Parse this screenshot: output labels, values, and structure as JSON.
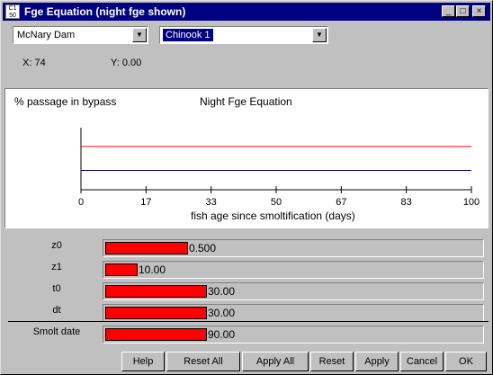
{
  "window": {
    "title": "Fge Equation (night fge shown)",
    "icon_text": "C1 50",
    "controls": {
      "minimize": "_",
      "maximize": "□",
      "close": "×"
    }
  },
  "selectors": {
    "dam": {
      "value": "McNary Dam",
      "arrow": "▼"
    },
    "species": {
      "value": "Chinook 1",
      "arrow": "▼"
    }
  },
  "coords": {
    "x": "X: 74",
    "y": "Y: 0.00"
  },
  "chart_data": {
    "type": "line",
    "title": "Night Fge Equation",
    "ylabel": "% passage in bypass",
    "xlabel": "fish age since smoltification (days)",
    "x_ticks": [
      "0",
      "17",
      "33",
      "50",
      "67",
      "83",
      "100"
    ],
    "xlim": [
      0,
      100
    ],
    "series": [
      {
        "color": "#ff0000",
        "x": [
          0,
          100
        ],
        "level": 0.74
      },
      {
        "color": "#000080",
        "x": [
          0,
          100
        ],
        "level": 0.33
      }
    ],
    "grid": false
  },
  "params": [
    {
      "name": "z0",
      "value": "0.500",
      "fraction": 0.22
    },
    {
      "name": "z1",
      "value": "10.00",
      "fraction": 0.085
    },
    {
      "name": "t0",
      "value": "30.00",
      "fraction": 0.27
    },
    {
      "name": "dt",
      "value": "30.00",
      "fraction": 0.27
    },
    {
      "name": "Smolt date",
      "value": "90.00",
      "fraction": 0.27
    }
  ],
  "buttons": {
    "help": "Help",
    "reset_all": "Reset All",
    "apply_all": "Apply All",
    "reset": "Reset",
    "apply": "Apply",
    "cancel": "Cancel",
    "ok": "OK"
  }
}
